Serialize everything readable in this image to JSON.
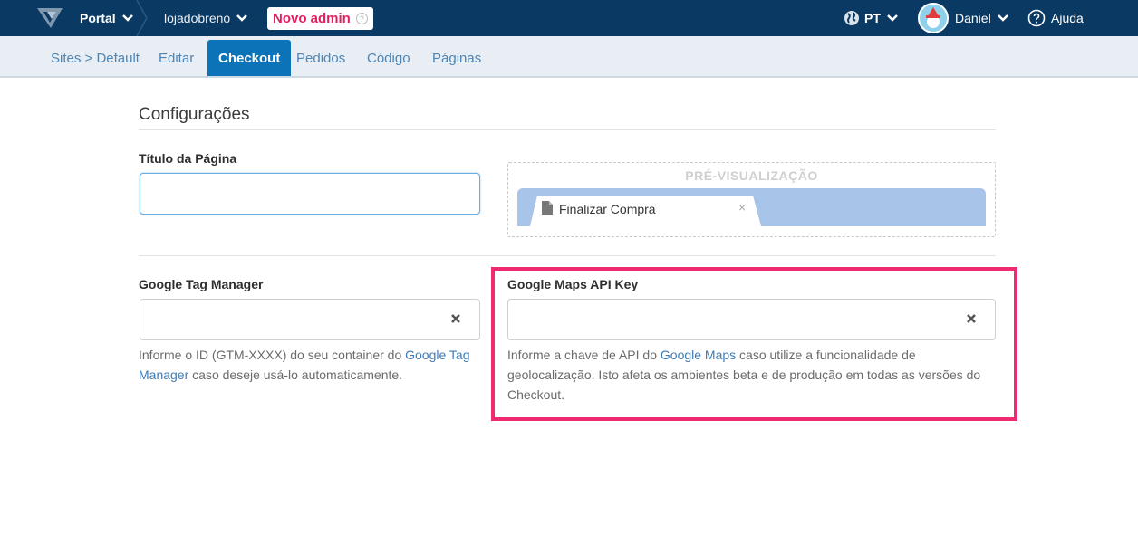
{
  "topbar": {
    "portal_label": "Portal",
    "store_label": "lojadobreno",
    "new_admin_label": "Novo admin",
    "help_q": "?",
    "lang_label": "PT",
    "user_label": "Daniel",
    "help_label": "Ajuda"
  },
  "subnav": {
    "tabs": [
      {
        "label": "Sites > Default"
      },
      {
        "label": "Editar"
      },
      {
        "label": "Checkout"
      },
      {
        "label": "Pedidos"
      },
      {
        "label": "Código"
      },
      {
        "label": "Páginas"
      }
    ],
    "active_index": 2
  },
  "main": {
    "section_title": "Configurações",
    "page_title_label": "Título da Página",
    "page_title_value": "",
    "preview": {
      "title": "PRÉ-VISUALIZAÇÃO",
      "tab_text": "Finalizar Compra",
      "close_glyph": "×"
    },
    "gtm": {
      "label": "Google Tag Manager",
      "value": "",
      "help_before": "Informe o ID (GTM-XXXX) do seu container do ",
      "help_link": "Google Tag Manager",
      "help_after": " caso deseje usá-lo automaticamente."
    },
    "maps": {
      "label": "Google Maps API Key",
      "value": "",
      "help_before": "Informe a chave de API do ",
      "help_link": "Google Maps",
      "help_after": " caso utilize a funcionalidade de geolocalização. Isto afeta os ambientes beta e de produção em todas as versões do Checkout."
    }
  },
  "colors": {
    "topbar": "#0a3a63",
    "subnav": "#e8eef4",
    "active_tab": "#0d73b8",
    "link": "#3d7bb5",
    "highlight": "#ee2a73",
    "new_admin": "#e0205f"
  },
  "icons": [
    "vtex-logo-icon",
    "chevron-down-icon",
    "globe-icon",
    "help-circle-icon",
    "clear-x-icon",
    "document-icon"
  ]
}
